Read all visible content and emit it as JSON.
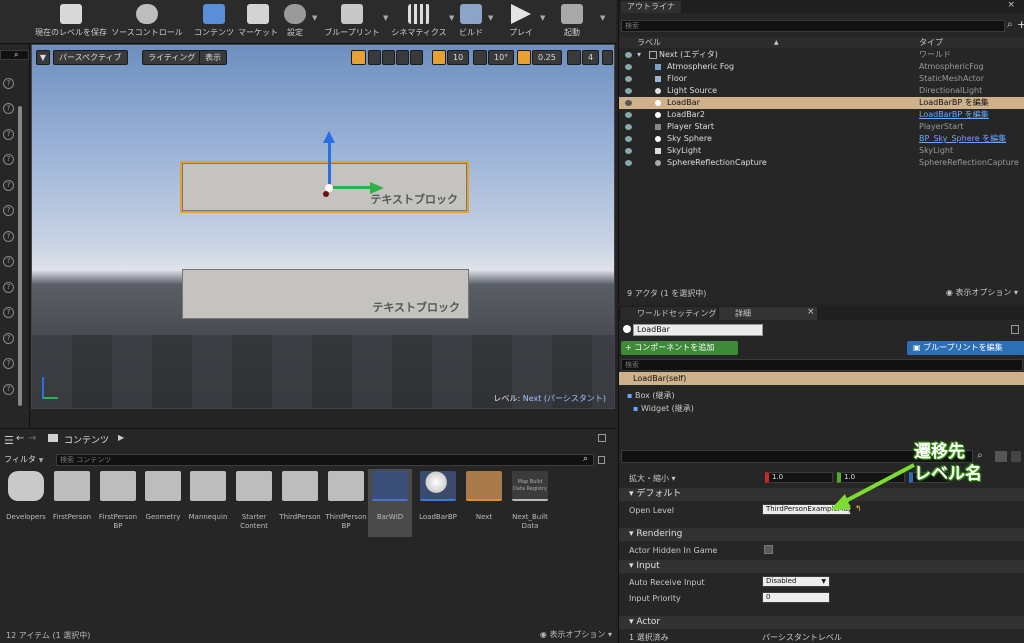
{
  "toolbar": {
    "items": [
      {
        "label": "現在のレベルを保存",
        "icon": "save-icon"
      },
      {
        "label": "ソースコントロール",
        "icon": "source-control-icon"
      },
      {
        "label": "コンテンツ",
        "icon": "content-icon"
      },
      {
        "label": "マーケット",
        "icon": "marketplace-icon"
      },
      {
        "label": "設定",
        "icon": "settings-icon"
      },
      {
        "label": "ブループリント",
        "icon": "blueprint-icon"
      },
      {
        "label": "シネマティクス",
        "icon": "cinematics-icon"
      },
      {
        "label": "ビルド",
        "icon": "build-icon"
      },
      {
        "label": "プレイ",
        "icon": "play-icon"
      },
      {
        "label": "起動",
        "icon": "launch-icon"
      }
    ]
  },
  "viewport": {
    "perspective_label": "パースペクティブ",
    "lighting_label": "ライティング",
    "show_label": "表示",
    "grid_snap": "10",
    "rotation_snap": "10°",
    "scale_snap": "0.25",
    "camera_speed": "4",
    "panel_text_1": "テキストブロック",
    "panel_text_2": "テキストブロック",
    "level_prefix": "レベル:",
    "level_name": "Next (パーシスタント)"
  },
  "content_browser": {
    "path_label": "コンテンツ",
    "filter_label": "フィルタ",
    "search_placeholder": "検索 コンテンツ",
    "items": [
      {
        "label": "Developers"
      },
      {
        "label": "FirstPerson"
      },
      {
        "label": "FirstPerson BP"
      },
      {
        "label": "Geometry"
      },
      {
        "label": "Mannequin"
      },
      {
        "label": "Starter Content"
      },
      {
        "label": "ThirdPerson"
      },
      {
        "label": "ThirdPerson BP"
      },
      {
        "label": "BarWID"
      },
      {
        "label": "LoadBarBP"
      },
      {
        "label": "Next"
      },
      {
        "label": "Next_Built Data"
      }
    ],
    "registry_text": "Map Build Data Registry",
    "status": "12 アイテム (1 選択中)",
    "view_options": "表示オプション"
  },
  "outliner": {
    "tab_label": "アウトライナ",
    "search_placeholder": "検索",
    "col_label": "ラベル",
    "col_type": "タイプ",
    "rows": [
      {
        "label": "Next (エディタ)",
        "type": "ワールド"
      },
      {
        "label": "Atmospheric Fog",
        "type": "AtmosphericFog"
      },
      {
        "label": "Floor",
        "type": "StaticMeshActor"
      },
      {
        "label": "Light Source",
        "type": "DirectionalLight"
      },
      {
        "label": "LoadBar",
        "type": "LoadBarBP を編集"
      },
      {
        "label": "LoadBar2",
        "type": "LoadBarBP を編集"
      },
      {
        "label": "Player Start",
        "type": "PlayerStart"
      },
      {
        "label": "Sky Sphere",
        "type": "BP_Sky_Sphere を編集"
      },
      {
        "label": "SkyLight",
        "type": "SkyLight"
      },
      {
        "label": "SphereReflectionCapture",
        "type": "SphereReflectionCapture"
      }
    ],
    "status": "9 アクタ (1 を選択中)",
    "view_options": "表示オプション"
  },
  "details": {
    "tab_world": "ワールドセッティング",
    "tab_details": "詳細",
    "name_value": "LoadBar",
    "add_component": "+ コンポーネントを追加",
    "edit_blueprint": "ブループリントを編集",
    "search_placeholder": "検索",
    "self_label": "LoadBar(self)",
    "box_label": "Box (継承)",
    "widget_label": "Widget (継承)",
    "scale_label": "拡大・縮小",
    "scale_x": "1.0",
    "scale_y": "1.0",
    "section_default": "デフォルト",
    "open_level_label": "Open Level",
    "open_level_value": "ThirdPersonExampleMap",
    "section_rendering": "Rendering",
    "actor_hidden_label": "Actor Hidden In Game",
    "section_input": "Input",
    "auto_receive_label": "Auto Receive Input",
    "auto_receive_value": "Disabled",
    "input_priority_label": "Input Priority",
    "input_priority_value": "0",
    "section_actor": "Actor",
    "selected_label": "1 選択済み",
    "selected_value": "パーシスタントレベル"
  },
  "annotation": {
    "line1": "遷移先",
    "line2": "レベル名"
  },
  "colors": {
    "selected_row": "#cfb18b",
    "accent_green": "#7ddc2f",
    "accent_blue": "#2d6fb5"
  }
}
